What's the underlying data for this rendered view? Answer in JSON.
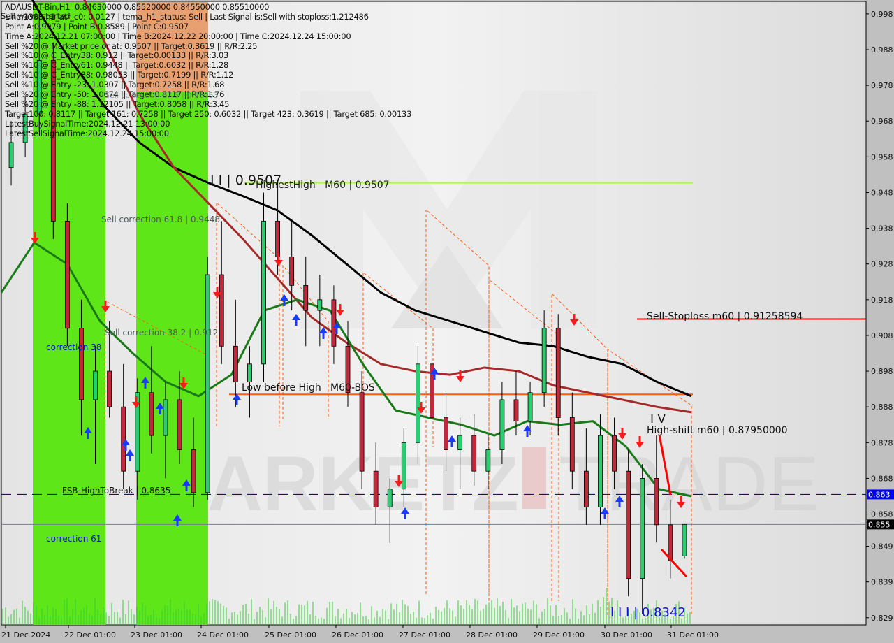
{
  "window": {
    "symbol_line": "ADAUSDT-Bin,H1  0.84630000 0.85520000 0.84550000 0.85510000",
    "overlay_text": "Sell wave started"
  },
  "info_lines": [
    "ADAUSDT-Bin,H1  0.84630000 0.85520000 0.84550000 0.85510000",
    "Line:1388 h1_atr_c0: 0.0127 | tema_h1_status: Sell | Last Signal is:Sell with stoploss:1.212486",
    "Point A:0.9979 | Point B:0.8589 | Point C:0.9507",
    "Time A:2024.12.21 07:00:00 | Time B:2024.12.22 20:00:00 | Time C:2024.12.24 15:00:00",
    "Sell %20 @ Market price or at: 0.9507 || Target:0.3619 || R/R:2.25",
    "Sell %10 @ C_Entry38: 0.912 || Target:0.00133 || R/R:3.03",
    "Sell %10 @ C_Entry61: 0.9448 || Target:0.6032 || R/R:1.28",
    "Sell %10 @ C_Entry88: 0.98053 || Target:0.7199 || R/R:1.12",
    "Sell %10 @ Entry -23: 1.0307 || Target:0.7258 || R/R:1.68",
    "Sell %20 @ Entry -50: 1.0674 || Target:0.8117 || R/R:1.76",
    "Sell %20 @ Entry -88: 1.12105 || Target:0.8058 || R/R:3.45",
    "Target100: 0.8117 || Target 161: 0.7258 || Target 250: 0.6032 || Target 423: 0.3619 || Target 685: 0.00133",
    "LatestBuySignalTime:2024.12.21 13:00:00",
    "LatestSellSignalTime:2024.12.24 15:00:00"
  ],
  "annotations": {
    "wave_ii": "I I | 0.9507",
    "highest_high": "HighestHigh   M60 | 0.9507",
    "sell_corr_618": "Sell correction 61.8 | 0.9448",
    "sell_corr_382": "Sell correction 38.2 | 0.912",
    "sell_corr_875": "Sell correction 87.5 | 0.98053",
    "correction_38": "correction 38",
    "correction_61": "correction 61",
    "low_before_high": "Low before High   M60-BOS",
    "sell_stoploss": "Sell-Stoploss m60 | 0.91258594",
    "wave_iv": "I V",
    "high_shift": "High-shift m60 | 0.87950000",
    "fsb": "FSB-HighToBreak | 0.8635",
    "wave_iii": "I I I | 0.8342"
  },
  "colors": {
    "background": "#dcdcdc",
    "axis_panel": "#c0c0c0",
    "green_zone": "#5fe619",
    "orange_zone": "#e8a070",
    "bull_candle": "#2ecc71",
    "bear_candle": "#c0283c",
    "ma_black": "#000000",
    "ma_brown": "#a52a2a",
    "ma_green": "#1a7a1a",
    "stoploss_line": "#e00000",
    "highest_high_line": "#adff2f",
    "bos_line": "#ff5a10",
    "fsb_line": "#0000e0",
    "current_price_line": "#708090",
    "volume": "#32cd32"
  },
  "chart_data": {
    "type": "candlestick",
    "title": "ADAUSDT-Bin,H1",
    "timeframe": "H1",
    "ohlc_last": {
      "open": 0.8463,
      "high": 0.8552,
      "low": 0.8455,
      "close": 0.8551
    },
    "x_ticks": [
      "21 Dec 2024",
      "22 Dec 01:00",
      "23 Dec 01:00",
      "24 Dec 01:00",
      "25 Dec 01:00",
      "26 Dec 01:00",
      "27 Dec 01:00",
      "28 Dec 01:00",
      "29 Dec 01:00",
      "30 Dec 01:00",
      "31 Dec 01:00"
    ],
    "y_ticks": [
      "0.998",
      "0.988",
      "0.978",
      "0.968",
      "0.958",
      "0.948",
      "0.938",
      "0.928",
      "0.918",
      "0.908",
      "0.898",
      "0.888",
      "0.878",
      "0.868",
      "0.858",
      "0.849",
      "0.839",
      "0.829"
    ],
    "ylim": [
      0.827,
      1.0015
    ],
    "price_tags": [
      {
        "label": "0.863",
        "value": 0.8635,
        "color": "#0000ff"
      },
      {
        "label": "0.855",
        "value": 0.8551,
        "color": "#000000"
      }
    ],
    "levels": [
      {
        "name": "HighestHigh M60",
        "value": 0.9507
      },
      {
        "name": "Sell-Stoploss m60",
        "value": 0.91258594
      },
      {
        "name": "Low before High M60-BOS",
        "value": 0.8915
      },
      {
        "name": "High-shift m60",
        "value": 0.8795
      },
      {
        "name": "FSB-HighToBreak",
        "value": 0.8635
      },
      {
        "name": "Current price",
        "value": 0.8551
      }
    ],
    "points": {
      "A": 0.9979,
      "B": 0.8589,
      "C": 0.9507,
      "III": 0.8342
    },
    "series": [
      {
        "name": "MA black",
        "values": [
          1.02,
          1.0,
          0.985,
          0.972,
          0.962,
          0.955,
          0.9507,
          0.947,
          0.943,
          0.936,
          0.928,
          0.92,
          0.915,
          0.912,
          0.909,
          0.906,
          0.905,
          0.902,
          0.9,
          0.895,
          0.891
        ]
      },
      {
        "name": "MA brown",
        "values": [
          1.05,
          1.03,
          1.01,
          0.99,
          0.97,
          0.955,
          0.945,
          0.935,
          0.924,
          0.913,
          0.906,
          0.9,
          0.898,
          0.897,
          0.899,
          0.898,
          0.894,
          0.892,
          0.89,
          0.888,
          0.8865
        ]
      },
      {
        "name": "MA green",
        "values": [
          0.92,
          0.934,
          0.928,
          0.912,
          0.903,
          0.895,
          0.891,
          0.897,
          0.915,
          0.918,
          0.915,
          0.9,
          0.887,
          0.885,
          0.883,
          0.88,
          0.884,
          0.883,
          0.884,
          0.877,
          0.865,
          0.863
        ]
      }
    ],
    "candles": [
      [
        0.955,
        0.968,
        0.95,
        0.962
      ],
      [
        0.962,
        0.975,
        0.958,
        0.97
      ],
      [
        0.97,
        0.998,
        0.965,
        0.985
      ],
      [
        0.985,
        0.99,
        0.935,
        0.94
      ],
      [
        0.94,
        0.945,
        0.905,
        0.91
      ],
      [
        0.91,
        0.918,
        0.88,
        0.89
      ],
      [
        0.89,
        0.905,
        0.872,
        0.898
      ],
      [
        0.898,
        0.912,
        0.885,
        0.888
      ],
      [
        0.888,
        0.9,
        0.865,
        0.87
      ],
      [
        0.87,
        0.896,
        0.862,
        0.892
      ],
      [
        0.892,
        0.905,
        0.875,
        0.88
      ],
      [
        0.88,
        0.895,
        0.868,
        0.89
      ],
      [
        0.89,
        0.898,
        0.872,
        0.876
      ],
      [
        0.876,
        0.885,
        0.86,
        0.864
      ],
      [
        0.864,
        0.93,
        0.862,
        0.925
      ],
      [
        0.925,
        0.94,
        0.9,
        0.905
      ],
      [
        0.905,
        0.918,
        0.888,
        0.895
      ],
      [
        0.895,
        0.905,
        0.885,
        0.9
      ],
      [
        0.9,
        0.948,
        0.895,
        0.94
      ],
      [
        0.94,
        0.951,
        0.925,
        0.93
      ],
      [
        0.93,
        0.94,
        0.915,
        0.922
      ],
      [
        0.922,
        0.93,
        0.905,
        0.915
      ],
      [
        0.915,
        0.925,
        0.905,
        0.918
      ],
      [
        0.918,
        0.922,
        0.9,
        0.905
      ],
      [
        0.905,
        0.912,
        0.888,
        0.892
      ],
      [
        0.892,
        0.898,
        0.865,
        0.87
      ],
      [
        0.87,
        0.878,
        0.855,
        0.86
      ],
      [
        0.86,
        0.868,
        0.85,
        0.865
      ],
      [
        0.865,
        0.882,
        0.86,
        0.878
      ],
      [
        0.878,
        0.905,
        0.872,
        0.9
      ],
      [
        0.9,
        0.905,
        0.88,
        0.885
      ],
      [
        0.885,
        0.892,
        0.87,
        0.876
      ],
      [
        0.876,
        0.885,
        0.865,
        0.88
      ],
      [
        0.88,
        0.886,
        0.866,
        0.87
      ],
      [
        0.87,
        0.88,
        0.865,
        0.876
      ],
      [
        0.876,
        0.895,
        0.872,
        0.89
      ],
      [
        0.89,
        0.898,
        0.88,
        0.884
      ],
      [
        0.884,
        0.895,
        0.88,
        0.892
      ],
      [
        0.892,
        0.915,
        0.888,
        0.91
      ],
      [
        0.91,
        0.914,
        0.88,
        0.885
      ],
      [
        0.885,
        0.892,
        0.865,
        0.87
      ],
      [
        0.87,
        0.882,
        0.855,
        0.86
      ],
      [
        0.86,
        0.886,
        0.855,
        0.88
      ],
      [
        0.88,
        0.885,
        0.865,
        0.87
      ],
      [
        0.87,
        0.876,
        0.835,
        0.84
      ],
      [
        0.84,
        0.872,
        0.83,
        0.868
      ],
      [
        0.868,
        0.88,
        0.85,
        0.855
      ],
      [
        0.855,
        0.862,
        0.84,
        0.845
      ],
      [
        0.8463,
        0.8552,
        0.8455,
        0.8551
      ]
    ],
    "volume_note": "green volume histogram along bottom"
  }
}
